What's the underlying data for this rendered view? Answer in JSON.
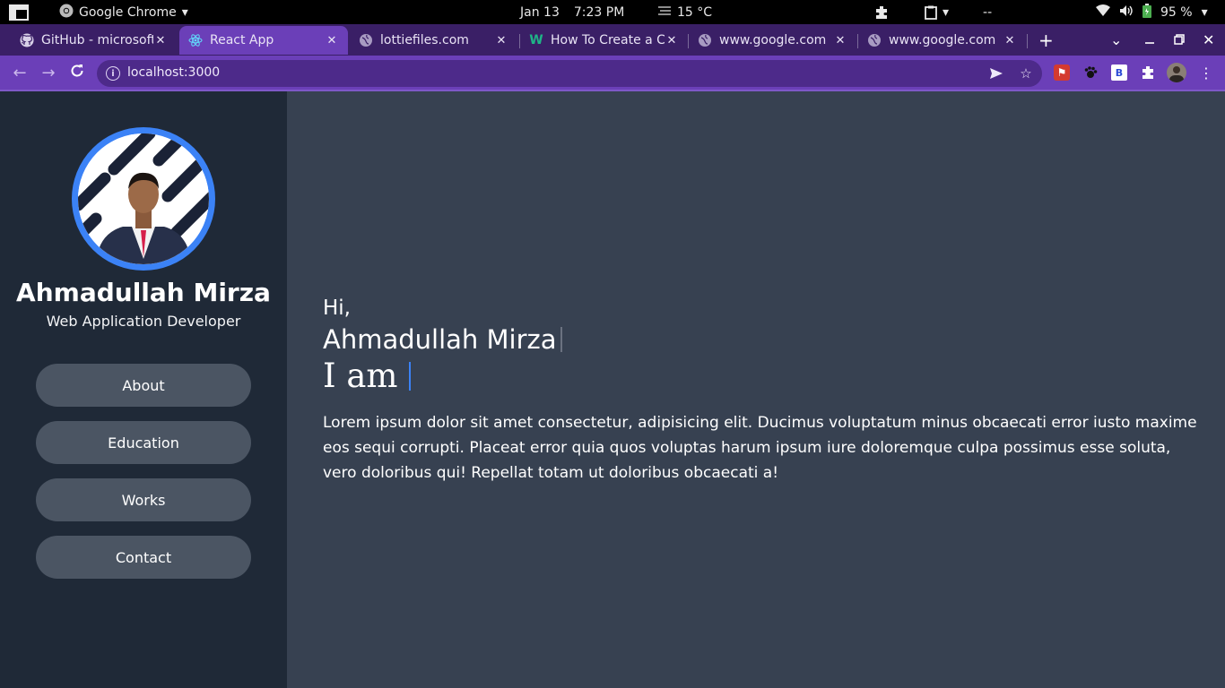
{
  "system_bar": {
    "app_name": "Google Chrome",
    "date": "Jan 13",
    "time": "7:23 PM",
    "temperature": "15 °C",
    "tray_text": "--",
    "battery": "95 %"
  },
  "tabs": [
    {
      "title": "GitHub - microsoft",
      "icon": "github-icon",
      "active": false
    },
    {
      "title": "React App",
      "icon": "react-icon",
      "active": true
    },
    {
      "title": "lottiefiles.com",
      "icon": "globe-icon",
      "active": false
    },
    {
      "title": "How To Create a C",
      "icon": "w-icon",
      "active": false
    },
    {
      "title": "www.google.com",
      "icon": "globe-icon",
      "active": false
    },
    {
      "title": "www.google.com",
      "icon": "globe-icon",
      "active": false
    }
  ],
  "toolbar": {
    "url": "localhost:3000"
  },
  "profile": {
    "name": "Ahmadullah Mirza",
    "role": "Web Application Developer",
    "accent_color": "#3b82f6"
  },
  "nav": [
    "About",
    "Education",
    "Works",
    "Contact"
  ],
  "hero": {
    "greeting": "Hi,",
    "name": "Ahmadullah Mirza",
    "i_am": "I am",
    "description": "Lorem ipsum dolor sit amet consectetur, adipisicing elit. Ducimus voluptatum minus obcaecati error iusto maxime eos sequi corrupti. Placeat error quia quos voluptas harum ipsum iure doloremque culpa possimus esse soluta, vero doloribus qui! Repellat totam ut doloribus obcaecati a!"
  }
}
